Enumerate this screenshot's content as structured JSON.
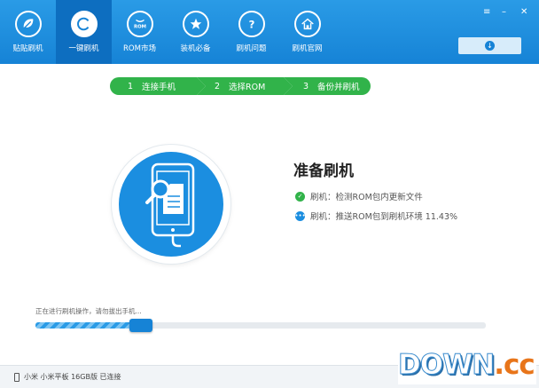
{
  "nav": [
    {
      "label": "贴贴刷机",
      "icon": "leaf-logo-icon",
      "active": false
    },
    {
      "label": "一键刷机",
      "icon": "refresh-icon",
      "active": true
    },
    {
      "label": "ROM市场",
      "icon": "rom-market-icon",
      "active": false
    },
    {
      "label": "装机必备",
      "icon": "star-icon",
      "active": false
    },
    {
      "label": "刷机问题",
      "icon": "question-icon",
      "active": false
    },
    {
      "label": "刷机官网",
      "icon": "home-icon",
      "active": false
    }
  ],
  "window": {
    "menu_glyph": "≡",
    "min_glyph": "–",
    "close_glyph": "✕"
  },
  "steps": [
    {
      "num": "1",
      "label": "连接手机"
    },
    {
      "num": "2",
      "label": "选择ROM"
    },
    {
      "num": "3",
      "label": "备份并刷机"
    }
  ],
  "main": {
    "title": "准备刷机",
    "status": [
      {
        "text": "刷机：检测ROM包内更新文件",
        "state": "done",
        "icon": "check-icon"
      },
      {
        "text": "刷机：推送ROM包到刷机环境 11.43%",
        "state": "in-progress",
        "icon": "loading-icon"
      }
    ]
  },
  "progress": {
    "text": "正在进行刷机操作，请勿拔出手机...",
    "fraction": 0.26
  },
  "footer": {
    "device": "小米 小米平板 16GB版 已连接"
  },
  "watermark": {
    "main": "DOWN",
    "dot": ".",
    "suffix": "cc"
  },
  "colors": {
    "brand_blue": "#1683d6",
    "step_green": "#31b34a",
    "watermark_orange": "#e8751a"
  }
}
